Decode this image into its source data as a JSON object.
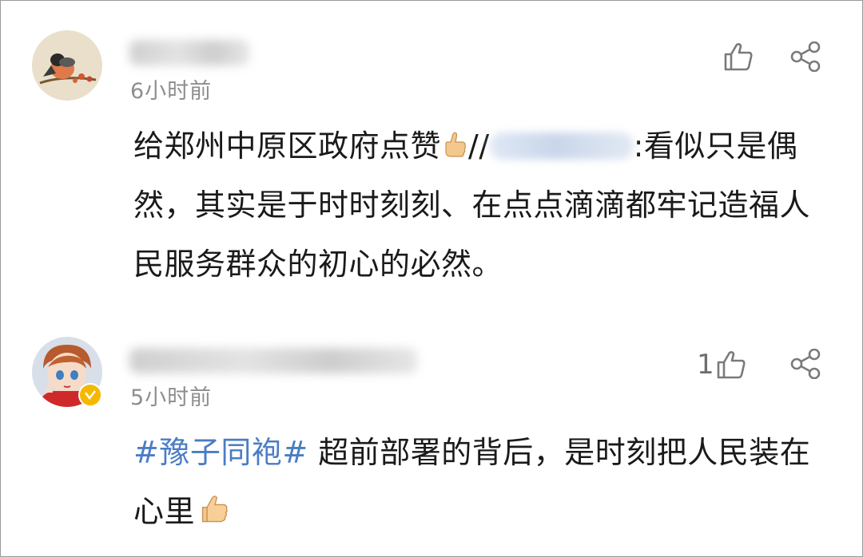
{
  "comments": [
    {
      "name": "",
      "time": "6小时前",
      "text_part1": "给郑州中原区政府点赞",
      "text_part2": "//",
      "text_part3": ":看似只是偶然，其实是于时时刻刻、在点点滴滴都牢记造福人民服务群众的初心的必然。",
      "like_count": "",
      "icons": [
        "thumbs-up-icon",
        "share-icon"
      ]
    },
    {
      "name": "",
      "time": "5小时前",
      "topic": "#豫子同袍#",
      "text": " 超前部署的背后，是时刻把人民装在心里",
      "like_count": "1",
      "badge": "verified-badge",
      "icons": [
        "thumbs-up-icon",
        "share-icon"
      ]
    }
  ],
  "colors": {
    "topic": "#4a7dc4",
    "time": "#8e8e8e",
    "icon": "#7a7a7a",
    "badge": "#f5b800"
  }
}
